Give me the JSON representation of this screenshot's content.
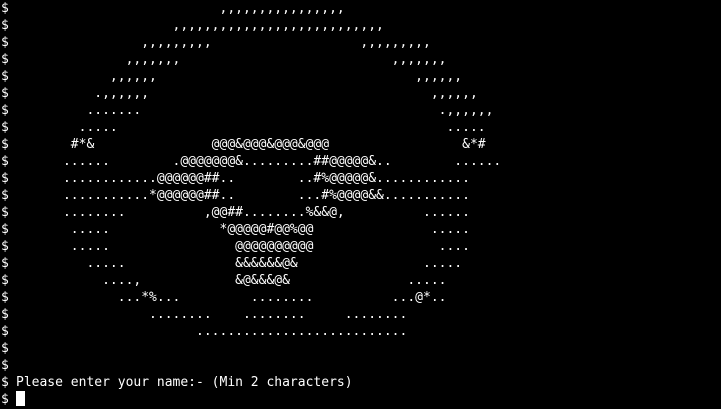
{
  "terminal": {
    "prompt_symbol": "$",
    "lines": [
      "                          ,,,,,,,,,,,,,,,,",
      "                    ,,,,,,,,,,,,,,,,,,,,,,,,,,,",
      "                ,,,,,,,,,                   ,,,,,,,,,",
      "              ,,,,,,,                           ,,,,,,,",
      "            ,,,,,,                                 ,,,,,,",
      "          .,,,,,,                                    ,,,,,,",
      "         .......                                      .,,,,,,",
      "        .....                                          .....",
      "       #*&               @@@&@@@&@@@&@@@                 &*#",
      "      ......        .@@@@@@@&.........##@@@@@&..        ......",
      "      ............@@@@@@##..        ..#%@@@@@&............",
      "      ...........*@@@@@@##..        ...#%@@@@&&...........",
      "      ........          ,@@##........%&&@,          ......",
      "       .....              *@@@@@#@@%@@               .....",
      "       .....                @@@@@@@@@@                ....",
      "         .....              &&&&&&@&                .....",
      "           ....,            &@&&&@&               .....",
      "             ...*%...         ........          ...@*..",
      "                 ........    ........     ........",
      "                       ...........................",
      "",
      ""
    ],
    "input_prompt": "Please enter your name:- (Min 2 characters)"
  },
  "colors": {
    "background": "#000000",
    "foreground": "#ffffff"
  }
}
